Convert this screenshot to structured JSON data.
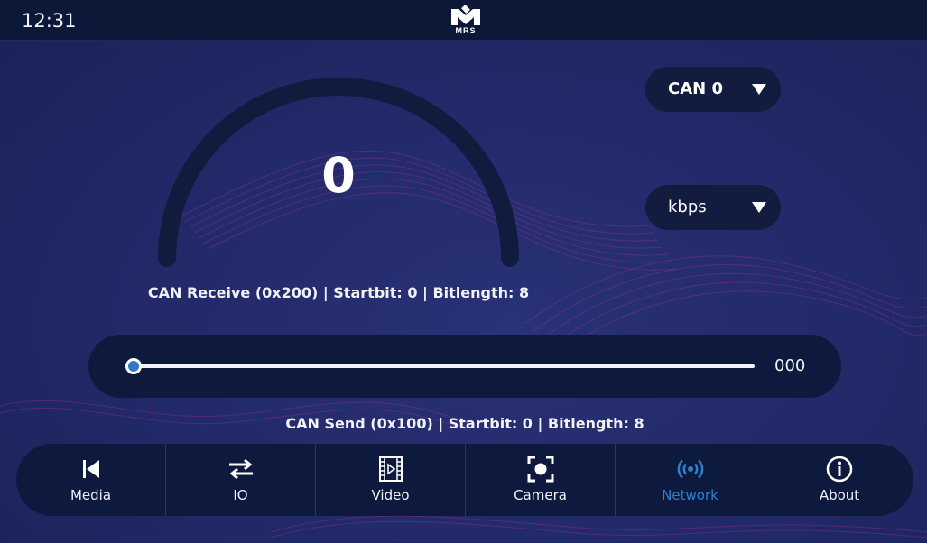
{
  "statusbar": {
    "time": "12:31"
  },
  "logo": {
    "text": "MRS",
    "icon": "mrs-logo"
  },
  "gauge": {
    "value": "0",
    "fill_fraction": 0,
    "label": "CAN Receive (0x200) | Startbit: 0 | Bitlength: 8"
  },
  "dropdowns": {
    "channel": {
      "selected": "CAN 0",
      "icon": "caret-down-icon"
    },
    "bitrate": {
      "selected": "kbps",
      "icon": "caret-down-icon"
    }
  },
  "slider": {
    "value_text": "000",
    "fraction": 0,
    "label": "CAN Send (0x100) | Startbit: 0 | Bitlength: 8"
  },
  "nav": {
    "active": "Network",
    "active_color": "#2e7fd0",
    "items": [
      {
        "label": "Media",
        "icon": "skip-back-icon"
      },
      {
        "label": "IO",
        "icon": "swap-arrows-icon"
      },
      {
        "label": "Video",
        "icon": "film-play-icon"
      },
      {
        "label": "Camera",
        "icon": "camera-focus-icon"
      },
      {
        "label": "Network",
        "icon": "wireless-signal-icon"
      },
      {
        "label": "About",
        "icon": "info-icon"
      }
    ]
  },
  "colors": {
    "background": "#222a6a",
    "panel": "#0e1a3d",
    "accent": "#2e7fd0",
    "wave": "#b0309a"
  }
}
